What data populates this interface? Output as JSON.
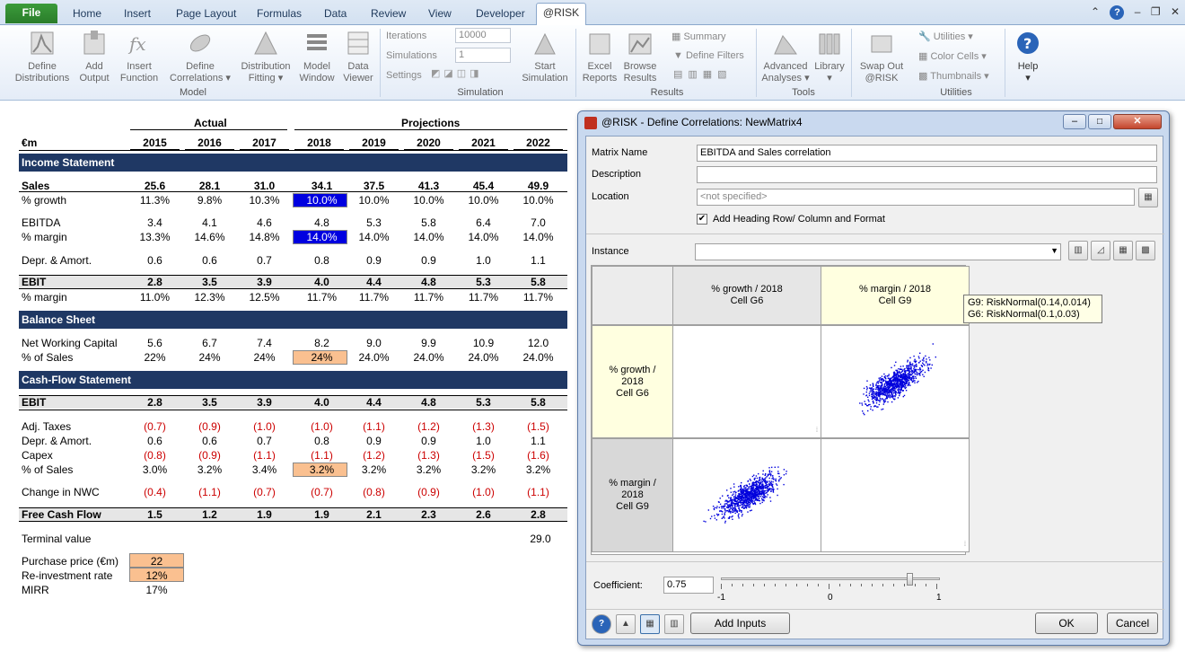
{
  "ribbon": {
    "tabs": [
      "Home",
      "Insert",
      "Page Layout",
      "Formulas",
      "Data",
      "Review",
      "View",
      "Developer"
    ],
    "file": "File",
    "active": "@RISK",
    "buttons": [
      {
        "l1": "Define",
        "l2": "Distributions"
      },
      {
        "l1": "Add",
        "l2": "Output"
      },
      {
        "l1": "Insert",
        "l2": "Function"
      },
      {
        "l1": "Define",
        "l2": "Correlations"
      },
      {
        "l1": "Distribution",
        "l2": "Fitting"
      },
      {
        "l1": "Model",
        "l2": "Window"
      },
      {
        "l1": "Data",
        "l2": "Viewer"
      }
    ],
    "groups": {
      "model": "Model",
      "simulation": "Simulation",
      "results": "Results",
      "tools": "Tools",
      "utilities": "Utilities"
    },
    "iterations_label": "Iterations",
    "iterations_value": "10000",
    "simulations_label": "Simulations",
    "simulations_value": "1",
    "settings_label": "Settings",
    "start": {
      "l1": "Start",
      "l2": "Simulation"
    },
    "excel": {
      "l1": "Excel",
      "l2": "Reports"
    },
    "browse": {
      "l1": "Browse",
      "l2": "Results"
    },
    "summary": "Summary",
    "define_filters": "Define Filters",
    "advanced": {
      "l1": "Advanced",
      "l2": "Analyses"
    },
    "library": "Library",
    "swap": {
      "l1": "Swap Out",
      "l2": "@RISK"
    },
    "utilities": "Utilities",
    "color_cells": "Color Cells",
    "thumbnails": "Thumbnails",
    "help": "Help"
  },
  "sheet": {
    "actual": "Actual",
    "projections": "Projections",
    "unit": "€m",
    "years": [
      "2015",
      "2016",
      "2017",
      "2018",
      "2019",
      "2020",
      "2021",
      "2022"
    ],
    "income_statement": "Income Statement",
    "balance_sheet": "Balance Sheet",
    "cash_flow": "Cash-Flow Statement",
    "rows": [
      {
        "label": "Sales",
        "v": [
          "25.6",
          "28.1",
          "31.0",
          "34.1",
          "37.5",
          "41.3",
          "45.4",
          "49.9"
        ],
        "bold": true
      },
      {
        "label": "% growth",
        "v": [
          "11.3%",
          "9.8%",
          "10.3%",
          "10.0%",
          "10.0%",
          "10.0%",
          "10.0%",
          "10.0%"
        ]
      },
      {
        "label": "EBITDA",
        "v": [
          "3.4",
          "4.1",
          "4.6",
          "4.8",
          "5.3",
          "5.8",
          "6.4",
          "7.0"
        ]
      },
      {
        "label": "% margin",
        "v": [
          "13.3%",
          "14.6%",
          "14.8%",
          "14.0%",
          "14.0%",
          "14.0%",
          "14.0%",
          "14.0%"
        ]
      },
      {
        "label": "Depr. & Amort.",
        "v": [
          "0.6",
          "0.6",
          "0.7",
          "0.8",
          "0.9",
          "0.9",
          "1.0",
          "1.1"
        ]
      },
      {
        "label": "EBIT",
        "v": [
          "2.8",
          "3.5",
          "3.9",
          "4.0",
          "4.4",
          "4.8",
          "5.3",
          "5.8"
        ],
        "bold": true
      },
      {
        "label": "% margin",
        "v": [
          "11.0%",
          "12.3%",
          "12.5%",
          "11.7%",
          "11.7%",
          "11.7%",
          "11.7%",
          "11.7%"
        ]
      },
      {
        "label": "Net Working Capital",
        "v": [
          "5.6",
          "6.7",
          "7.4",
          "8.2",
          "9.0",
          "9.9",
          "10.9",
          "12.0"
        ]
      },
      {
        "label": "% of Sales",
        "v": [
          "22%",
          "24%",
          "24%",
          "24%",
          "24.0%",
          "24.0%",
          "24.0%",
          "24.0%"
        ]
      },
      {
        "label": "EBIT",
        "v": [
          "2.8",
          "3.5",
          "3.9",
          "4.0",
          "4.4",
          "4.8",
          "5.3",
          "5.8"
        ],
        "bold": true
      },
      {
        "label": "Adj. Taxes",
        "v": [
          "(0.7)",
          "(0.9)",
          "(1.0)",
          "(1.0)",
          "(1.1)",
          "(1.2)",
          "(1.3)",
          "(1.5)"
        ],
        "neg": true
      },
      {
        "label": "Depr. & Amort.",
        "v": [
          "0.6",
          "0.6",
          "0.7",
          "0.8",
          "0.9",
          "0.9",
          "1.0",
          "1.1"
        ]
      },
      {
        "label": "Capex",
        "v": [
          "(0.8)",
          "(0.9)",
          "(1.1)",
          "(1.1)",
          "(1.2)",
          "(1.3)",
          "(1.5)",
          "(1.6)"
        ],
        "neg": true
      },
      {
        "label": "% of Sales",
        "v": [
          "3.0%",
          "3.2%",
          "3.4%",
          "3.2%",
          "3.2%",
          "3.2%",
          "3.2%",
          "3.2%"
        ]
      },
      {
        "label": "Change in NWC",
        "v": [
          "(0.4)",
          "(1.1)",
          "(0.7)",
          "(0.7)",
          "(0.8)",
          "(0.9)",
          "(1.0)",
          "(1.1)"
        ],
        "neg": true
      },
      {
        "label": "Free Cash Flow",
        "v": [
          "1.5",
          "1.2",
          "1.9",
          "1.9",
          "2.1",
          "2.3",
          "2.6",
          "2.8"
        ],
        "bold": true
      }
    ],
    "terminal_label": "Terminal value",
    "terminal_value": "29.0",
    "purchase_label": "Purchase price (€m)",
    "purchase_value": "22",
    "reinvest_label": "Re-investment rate",
    "reinvest_value": "12%",
    "mirr_label": "MIRR",
    "mirr_value": "17%"
  },
  "dialog": {
    "title": "@RISK - Define Correlations: NewMatrix4",
    "matrix_name_label": "Matrix Name",
    "matrix_name": "EBITDA and Sales correlation",
    "description_label": "Description",
    "description": "",
    "location_label": "Location",
    "location_placeholder": "<not specified>",
    "add_heading": "Add Heading Row/ Column and Format",
    "instance_label": "Instance",
    "col1": {
      "l1": "% growth / 2018",
      "l2": "Cell G6"
    },
    "col2": {
      "l1": "% margin / 2018",
      "l2": "Cell G9"
    },
    "row1": {
      "l1": "% growth /",
      "l2": "2018",
      "l3": "Cell G6"
    },
    "row2": {
      "l1": "% margin /",
      "l2": "2018",
      "l3": "Cell G9"
    },
    "tooltip1": "G9: RiskNormal(0.14,0.014)",
    "tooltip2": "G6: RiskNormal(0.1,0.03)",
    "coef_label": "Coefficient:",
    "coef_value": "0.75",
    "coef": 0.75,
    "scale_min": "-1",
    "scale_mid": "0",
    "scale_max": "1",
    "add_inputs": "Add Inputs",
    "ok": "OK",
    "cancel": "Cancel"
  }
}
